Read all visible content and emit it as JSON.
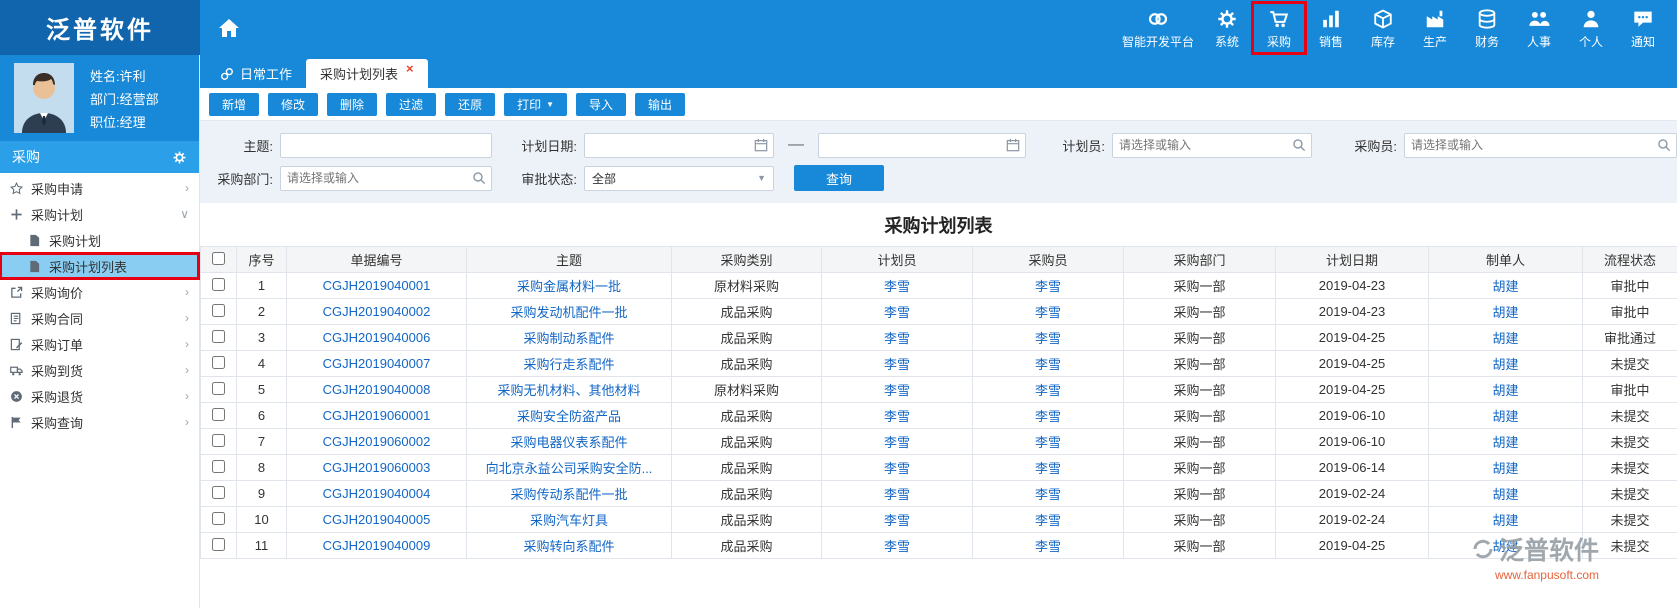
{
  "app": {
    "logo": "泛普软件"
  },
  "icons": {
    "caret_down": "▼"
  },
  "topbar": {
    "modules": [
      {
        "label": "智能开发平台",
        "icon": "cloud-link"
      },
      {
        "label": "系统",
        "icon": "gear"
      },
      {
        "label": "采购",
        "icon": "cart",
        "highlighted": true
      },
      {
        "label": "销售",
        "icon": "bar-chart"
      },
      {
        "label": "库存",
        "icon": "boxes"
      },
      {
        "label": "生产",
        "icon": "production"
      },
      {
        "label": "财务",
        "icon": "finance"
      },
      {
        "label": "人事",
        "icon": "people"
      },
      {
        "label": "个人",
        "icon": "person"
      },
      {
        "label": "通知",
        "icon": "notification"
      }
    ]
  },
  "user": {
    "name": "姓名:许利",
    "department": "部门:经营部",
    "position": "职位:经理"
  },
  "sidebar": {
    "section_title": "采购",
    "items": [
      {
        "label": "采购申请",
        "icon": "star",
        "arrow": "›"
      },
      {
        "label": "采购计划",
        "icon": "plus",
        "arrow": "∨",
        "expanded": true
      },
      {
        "label": "采购计划",
        "icon": "file",
        "child": true
      },
      {
        "label": "采购计划列表",
        "icon": "file",
        "child": true,
        "selected": true
      },
      {
        "label": "采购询价",
        "icon": "share",
        "arrow": "›"
      },
      {
        "label": "采购合同",
        "icon": "contract",
        "arrow": "›"
      },
      {
        "label": "采购订单",
        "icon": "order",
        "arrow": "›"
      },
      {
        "label": "采购到货",
        "icon": "delivery",
        "arrow": "›"
      },
      {
        "label": "采购退货",
        "icon": "return",
        "arrow": "›"
      },
      {
        "label": "采购查询",
        "icon": "query",
        "arrow": "›"
      }
    ]
  },
  "tabs": [
    {
      "label": "日常工作",
      "icon": "link"
    },
    {
      "label": "采购计划列表",
      "active": true,
      "close": "×"
    }
  ],
  "toolbar": {
    "buttons": [
      {
        "label": "新增"
      },
      {
        "label": "修改"
      },
      {
        "label": "删除"
      },
      {
        "label": "过滤"
      },
      {
        "label": "还原"
      },
      {
        "label": "打印",
        "dropdown": true
      },
      {
        "label": "导入"
      },
      {
        "label": "输出"
      }
    ]
  },
  "filters": {
    "subject_label": "主题:",
    "subject_value": "",
    "plan_date_label": "计划日期:",
    "date_from": "",
    "date_to": "",
    "range_separator": "—",
    "planner_label": "计划员:",
    "planner_placeholder": "请选择或输入",
    "buyer_label": "采购员:",
    "buyer_placeholder": "请选择或输入",
    "department_label": "采购部门:",
    "department_placeholder": "请选择或输入",
    "approval_label": "审批状态:",
    "approval_value": "全部",
    "search_button": "查询"
  },
  "list": {
    "title": "采购计划列表",
    "columns": [
      "序号",
      "单据编号",
      "主题",
      "采购类别",
      "计划员",
      "采购员",
      "采购部门",
      "计划日期",
      "制单人",
      "流程状态"
    ],
    "rows": [
      {
        "no": "1",
        "doc_no": "CGJH2019040001",
        "subject": "采购金属材料一批",
        "category": "原材料采购",
        "planner": "李雪",
        "buyer": "李雪",
        "department": "采购一部",
        "date": "2019-04-23",
        "creator": "胡建",
        "status": "审批中"
      },
      {
        "no": "2",
        "doc_no": "CGJH2019040002",
        "subject": "采购发动机配件一批",
        "category": "成品采购",
        "planner": "李雪",
        "buyer": "李雪",
        "department": "采购一部",
        "date": "2019-04-23",
        "creator": "胡建",
        "status": "审批中"
      },
      {
        "no": "3",
        "doc_no": "CGJH2019040006",
        "subject": "采购制动系配件",
        "category": "成品采购",
        "planner": "李雪",
        "buyer": "李雪",
        "department": "采购一部",
        "date": "2019-04-25",
        "creator": "胡建",
        "status": "审批通过"
      },
      {
        "no": "4",
        "doc_no": "CGJH2019040007",
        "subject": "采购行走系配件",
        "category": "成品采购",
        "planner": "李雪",
        "buyer": "李雪",
        "department": "采购一部",
        "date": "2019-04-25",
        "creator": "胡建",
        "status": "未提交"
      },
      {
        "no": "5",
        "doc_no": "CGJH2019040008",
        "subject": "采购无机材料、其他材料",
        "category": "原材料采购",
        "planner": "李雪",
        "buyer": "李雪",
        "department": "采购一部",
        "date": "2019-04-25",
        "creator": "胡建",
        "status": "审批中"
      },
      {
        "no": "6",
        "doc_no": "CGJH2019060001",
        "subject": "采购安全防盗产品",
        "category": "成品采购",
        "planner": "李雪",
        "buyer": "李雪",
        "department": "采购一部",
        "date": "2019-06-10",
        "creator": "胡建",
        "status": "未提交"
      },
      {
        "no": "7",
        "doc_no": "CGJH2019060002",
        "subject": "采购电器仪表系配件",
        "category": "成品采购",
        "planner": "李雪",
        "buyer": "李雪",
        "department": "采购一部",
        "date": "2019-06-10",
        "creator": "胡建",
        "status": "未提交"
      },
      {
        "no": "8",
        "doc_no": "CGJH2019060003",
        "subject": "向北京永益公司采购安全防...",
        "category": "成品采购",
        "planner": "李雪",
        "buyer": "李雪",
        "department": "采购一部",
        "date": "2019-06-14",
        "creator": "胡建",
        "status": "未提交"
      },
      {
        "no": "9",
        "doc_no": "CGJH2019040004",
        "subject": "采购传动系配件一批",
        "category": "成品采购",
        "planner": "李雪",
        "buyer": "李雪",
        "department": "采购一部",
        "date": "2019-02-24",
        "creator": "胡建",
        "status": "未提交"
      },
      {
        "no": "10",
        "doc_no": "CGJH2019040005",
        "subject": "采购汽车灯具",
        "category": "成品采购",
        "planner": "李雪",
        "buyer": "李雪",
        "department": "采购一部",
        "date": "2019-02-24",
        "creator": "胡建",
        "status": "未提交"
      },
      {
        "no": "11",
        "doc_no": "CGJH2019040009",
        "subject": "采购转向系配件",
        "category": "成品采购",
        "planner": "李雪",
        "buyer": "李雪",
        "department": "采购一部",
        "date": "2019-04-25",
        "creator": "胡建",
        "status": "未提交"
      }
    ]
  },
  "watermark": {
    "brand": "泛普软件",
    "url": "www.fanpusoft.com"
  }
}
